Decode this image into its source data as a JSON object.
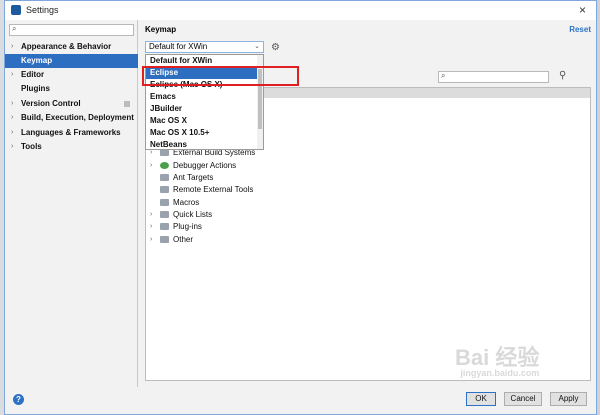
{
  "window": {
    "title": "Settings",
    "close_glyph": "×"
  },
  "sidebar": {
    "search_placeholder": "",
    "items": [
      {
        "label": "Appearance & Behavior",
        "arrow": "›"
      },
      {
        "label": "Keymap",
        "arrow": "",
        "selected": true
      },
      {
        "label": "Editor",
        "arrow": "›"
      },
      {
        "label": "Plugins",
        "arrow": ""
      },
      {
        "label": "Version Control",
        "arrow": "›"
      },
      {
        "label": "Build, Execution, Deployment",
        "arrow": "›"
      },
      {
        "label": "Languages & Frameworks",
        "arrow": "›"
      },
      {
        "label": "Tools",
        "arrow": "›"
      }
    ]
  },
  "keymap": {
    "title": "Keymap",
    "reset_label": "Reset",
    "selected_keymap": "Default for XWin",
    "dropdown_options": [
      "Default for XWin",
      "Eclipse",
      "Eclipse (Mac OS X)",
      "Emacs",
      "JBuilder",
      "Mac OS X",
      "Mac OS X 10.5+",
      "NetBeans"
    ],
    "highlighted_option": "Eclipse"
  },
  "tree": {
    "rows": [
      {
        "label": "External Build Systems",
        "arrow": "›",
        "icon": "folder"
      },
      {
        "label": "Debugger Actions",
        "arrow": "›",
        "icon": "green"
      },
      {
        "label": "Ant Targets",
        "arrow": "",
        "icon": "folder"
      },
      {
        "label": "Remote External Tools",
        "arrow": "",
        "icon": "folder"
      },
      {
        "label": "Macros",
        "arrow": "",
        "icon": "folder"
      },
      {
        "label": "Quick Lists",
        "arrow": "›",
        "icon": "folder"
      },
      {
        "label": "Plug-ins",
        "arrow": "›",
        "icon": "folder"
      },
      {
        "label": "Other",
        "arrow": "›",
        "icon": "folder"
      }
    ]
  },
  "footer": {
    "help_glyph": "?",
    "ok_label": "OK",
    "cancel_label": "Cancel",
    "apply_label": "Apply"
  },
  "watermark": {
    "text": "Bai 经验",
    "sub": "jingyan.baidu.com"
  },
  "colors": {
    "accent": "#2e6ec0",
    "highlight_border": "#e02020",
    "link": "#2d72c4"
  }
}
